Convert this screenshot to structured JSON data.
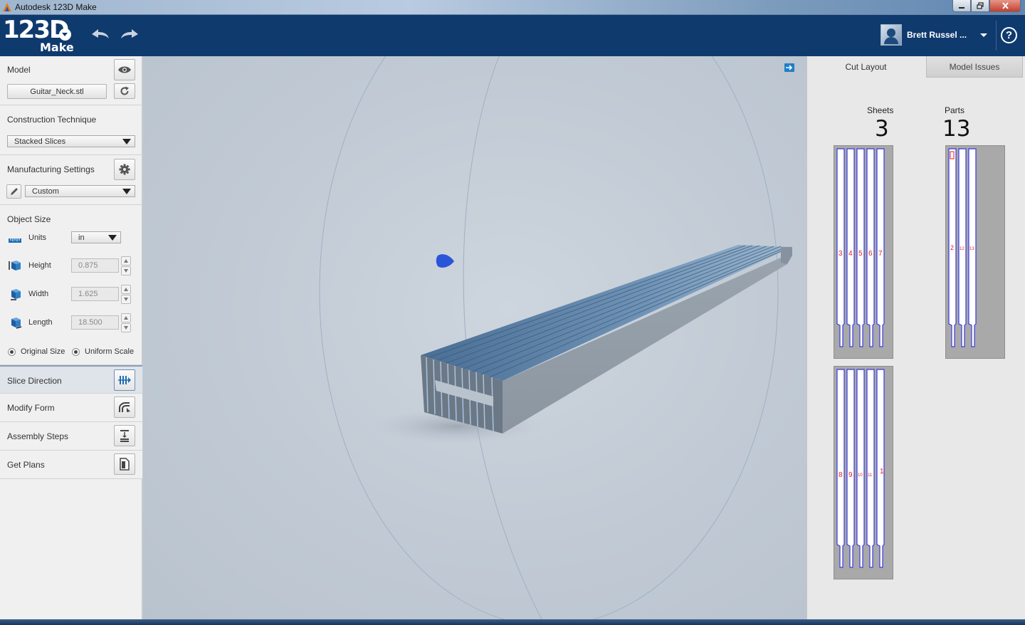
{
  "window": {
    "title": "Autodesk 123D Make",
    "controls": [
      "minimize",
      "maximize",
      "close"
    ]
  },
  "header": {
    "logo_number": "123D",
    "logo_product": "Make",
    "user_name": "Brett Russel ...",
    "help_glyph": "?"
  },
  "left_panel": {
    "model": {
      "title": "Model",
      "file": "Guitar_Neck.stl"
    },
    "construction": {
      "title": "Construction Technique",
      "selected": "Stacked Slices"
    },
    "manufacturing": {
      "title": "Manufacturing Settings",
      "selected": "Custom"
    },
    "object_size": {
      "title": "Object Size",
      "units_label": "Units",
      "units_value": "in",
      "height_label": "Height",
      "height_value": "0.875",
      "width_label": "Width",
      "width_value": "1.625",
      "length_label": "Length",
      "length_value": "18.500",
      "original_size_label": "Original Size",
      "uniform_scale_label": "Uniform Scale"
    },
    "steps": [
      {
        "label": "Slice Direction",
        "active": true
      },
      {
        "label": "Modify Form",
        "active": false
      },
      {
        "label": "Assembly Steps",
        "active": false
      },
      {
        "label": "Get Plans",
        "active": false
      }
    ]
  },
  "right_panel": {
    "tabs": [
      {
        "label": "Cut Layout",
        "active": true
      },
      {
        "label": "Model Issues",
        "active": false
      }
    ],
    "sheets_label": "Sheets",
    "sheets_count": "3",
    "parts_label": "Parts",
    "parts_count": "13",
    "sheet_part_numbers": [
      [
        "3",
        "4",
        "5",
        "6",
        "7"
      ],
      [
        "2",
        "12",
        "13"
      ],
      [
        "8",
        "9",
        "10",
        "11",
        "1"
      ]
    ]
  },
  "colors": {
    "header_bg": "#0f3a6e",
    "accent_blue": "#1f7ec8",
    "part_outline": "#3a3ae0",
    "part_label": "#e02020"
  }
}
